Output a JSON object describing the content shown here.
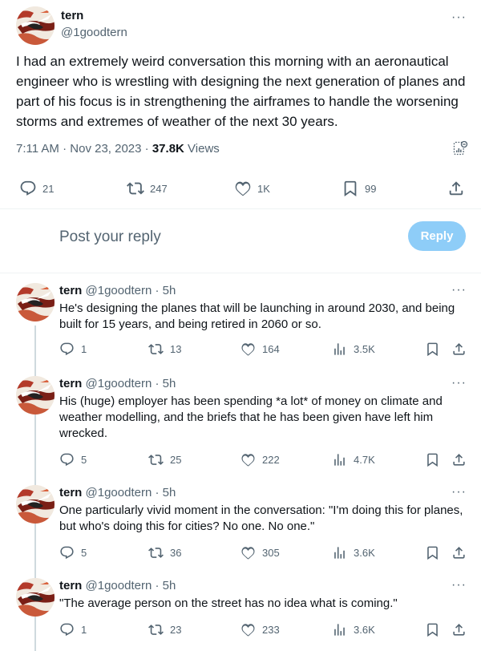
{
  "tweet": {
    "author_name": "tern",
    "author_handle": "@1goodtern",
    "more_icon": "···",
    "text": "I had an extremely weird conversation this morning with an aeronautical engineer who is wrestling with designing the next generation of planes and part of his focus is in strengthening the airframes to handle the worsening storms and extremes of weather of the next 30 years.",
    "time": "7:11 AM",
    "date": "Nov 23, 2023",
    "separator": "·",
    "views_count": "37.8K",
    "views_label": "Views",
    "stats": {
      "replies": "21",
      "reposts": "247",
      "likes": "1K",
      "bookmarks": "99"
    }
  },
  "composer": {
    "placeholder": "Post your reply",
    "button_label": "Reply"
  },
  "replies": [
    {
      "name": "tern",
      "handle": "@1goodtern",
      "time": "5h",
      "text": "He's designing the planes that will be launching in around 2030, and being built for 15 years, and being retired in 2060 or so.",
      "replies": "1",
      "reposts": "13",
      "likes": "164",
      "views": "3.5K"
    },
    {
      "name": "tern",
      "handle": "@1goodtern",
      "time": "5h",
      "text": "His (huge) employer has been spending *a lot* of money on climate and weather modelling, and the briefs that he has been given have left him wrecked.",
      "replies": "5",
      "reposts": "25",
      "likes": "222",
      "views": "4.7K"
    },
    {
      "name": "tern",
      "handle": "@1goodtern",
      "time": "5h",
      "text": "One particularly vivid moment in the conversation: \"I'm doing this for planes, but who's doing this for cities? No one. No one.\"",
      "replies": "5",
      "reposts": "36",
      "likes": "305",
      "views": "3.6K"
    },
    {
      "name": "tern",
      "handle": "@1goodtern",
      "time": "5h",
      "text": "\"The average person on the street has no idea what is coming.\"",
      "replies": "1",
      "reposts": "23",
      "likes": "233",
      "views": "3.6K"
    }
  ],
  "colors": {
    "text_primary": "#0f1419",
    "text_secondary": "#536471",
    "reply_button_bg": "#8ecdf8",
    "divider": "#eff3f4"
  },
  "icons": [
    "avatar-bird",
    "more-icon",
    "analytics-icon",
    "reply-icon",
    "repost-icon",
    "like-icon",
    "bookmark-icon",
    "share-icon",
    "views-icon"
  ]
}
